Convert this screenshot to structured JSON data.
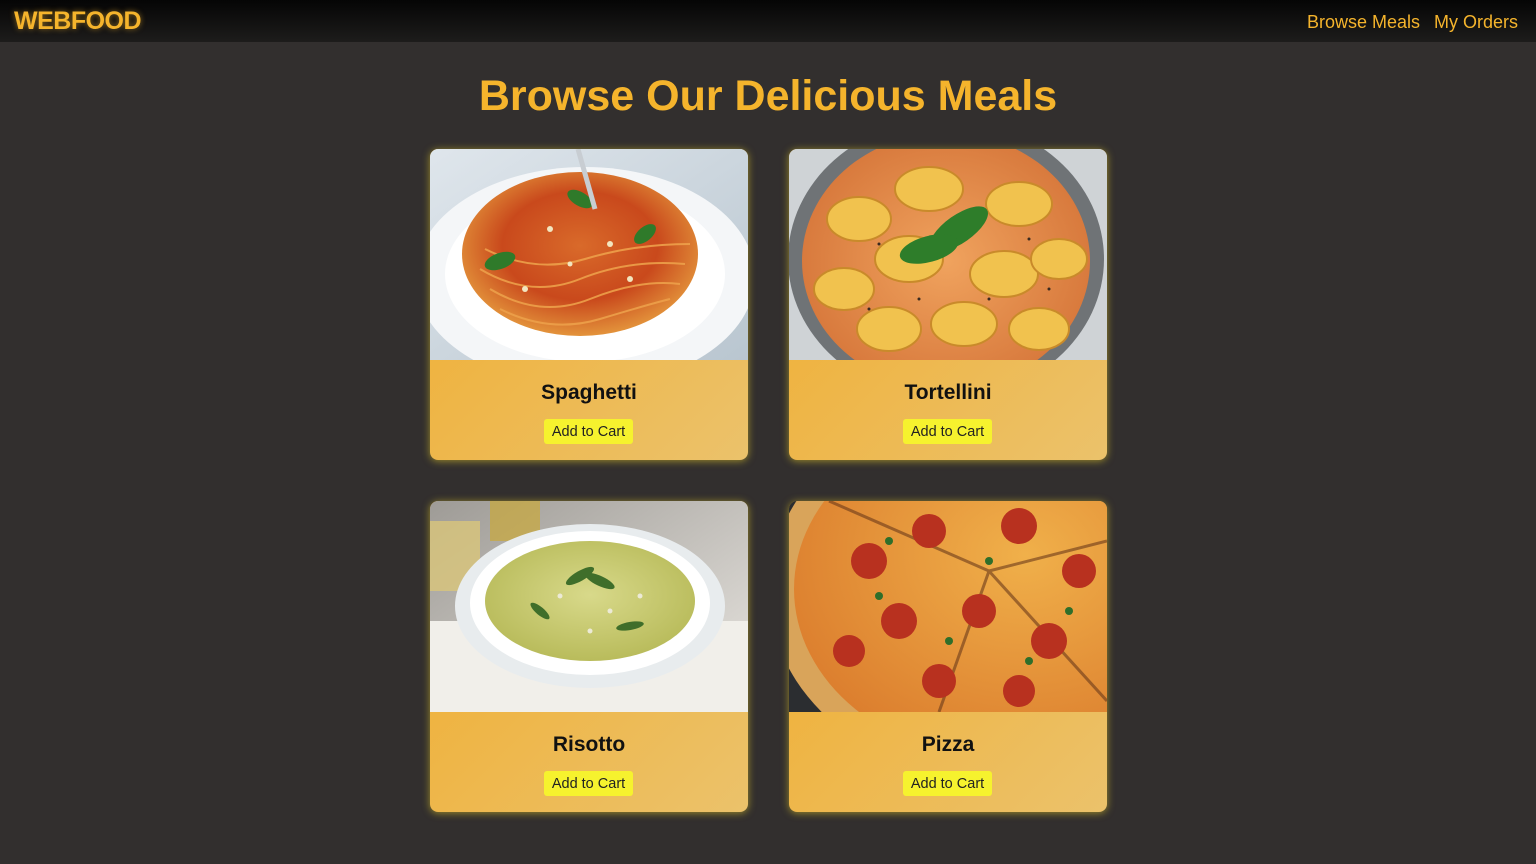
{
  "app": {
    "logo": "WEBFOOD"
  },
  "nav": {
    "links": [
      {
        "label": "Browse Meals"
      },
      {
        "label": "My Orders"
      }
    ]
  },
  "main": {
    "title": "Browse Our Delicious Meals"
  },
  "meals": [
    {
      "name": "Spaghetti",
      "button_label": "Add to Cart"
    },
    {
      "name": "Tortellini",
      "button_label": "Add to Cart"
    },
    {
      "name": "Risotto",
      "button_label": "Add to Cart"
    },
    {
      "name": "Pizza",
      "button_label": "Add to Cart"
    }
  ],
  "colors": {
    "accent": "#f5b42c",
    "background": "#322f2e",
    "button": "#f6f22e"
  }
}
